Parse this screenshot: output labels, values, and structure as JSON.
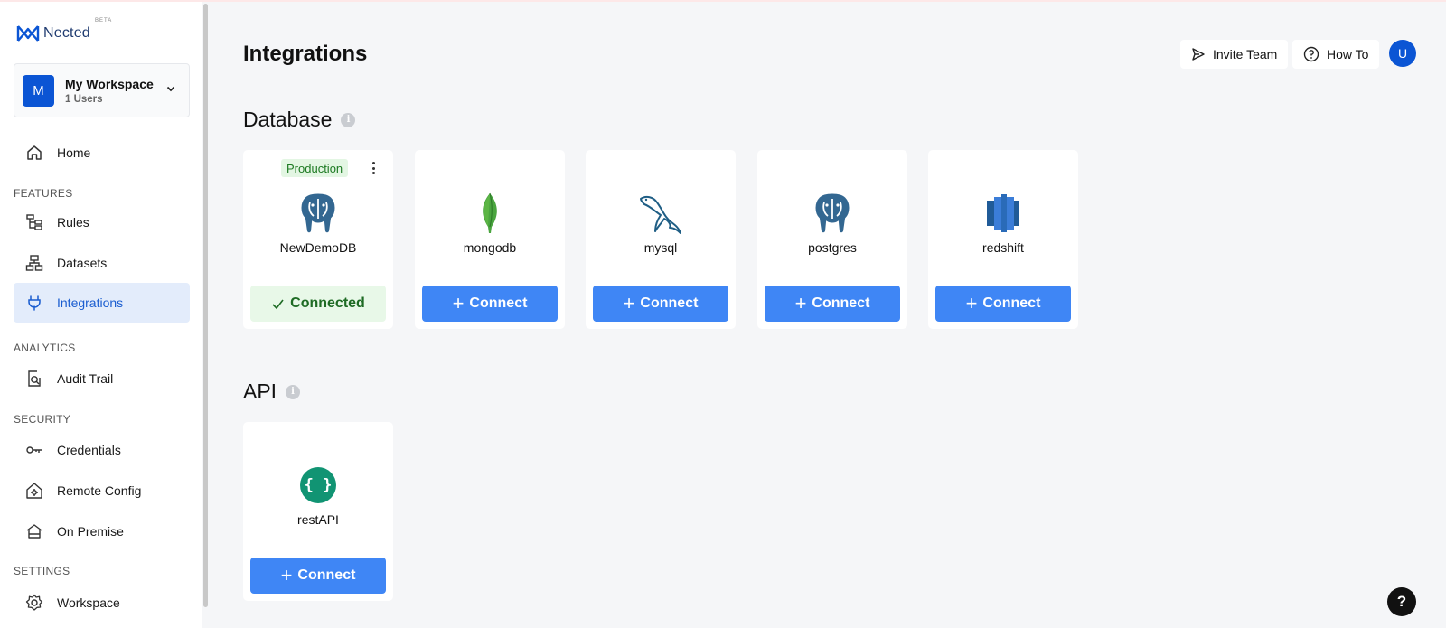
{
  "brand": {
    "name": "Nected",
    "beta": "BETA",
    "color": "#0b55d4"
  },
  "workspace": {
    "initial": "M",
    "name": "My Workspace",
    "users": "1 Users"
  },
  "sidebar": {
    "home": "Home",
    "features_label": "FEATURES",
    "rules": "Rules",
    "datasets": "Datasets",
    "integrations": "Integrations",
    "analytics_label": "ANALYTICS",
    "audit_trail": "Audit Trail",
    "security_label": "SECURITY",
    "credentials": "Credentials",
    "remote_config": "Remote Config",
    "on_premise": "On Premise",
    "settings_label": "SETTINGS",
    "workspace": "Workspace"
  },
  "header": {
    "title": "Integrations",
    "invite_team": "Invite Team",
    "how_to": "How To",
    "user_initial": "U"
  },
  "database": {
    "title": "Database",
    "info": "i",
    "cards": [
      {
        "name": "NewDemoDB",
        "badge": "Production",
        "button": "Connected",
        "icon": "postgres-elephant-icon"
      },
      {
        "name": "mongodb",
        "button": "Connect",
        "icon": "mongodb-leaf-icon"
      },
      {
        "name": "mysql",
        "button": "Connect",
        "icon": "mysql-dolphin-icon"
      },
      {
        "name": "postgres",
        "button": "Connect",
        "icon": "postgres-elephant-icon"
      },
      {
        "name": "redshift",
        "button": "Connect",
        "icon": "redshift-icon"
      }
    ]
  },
  "api": {
    "title": "API",
    "info": "i",
    "cards": [
      {
        "name": "restAPI",
        "button": "Connect",
        "icon": "rest-api-braces-icon",
        "glyph": "{ }"
      }
    ]
  },
  "help": {
    "label": "?"
  },
  "colors": {
    "accent": "#3f86f5",
    "active_nav_bg": "#e3ecfb",
    "connected_bg": "#e8f8e8"
  }
}
